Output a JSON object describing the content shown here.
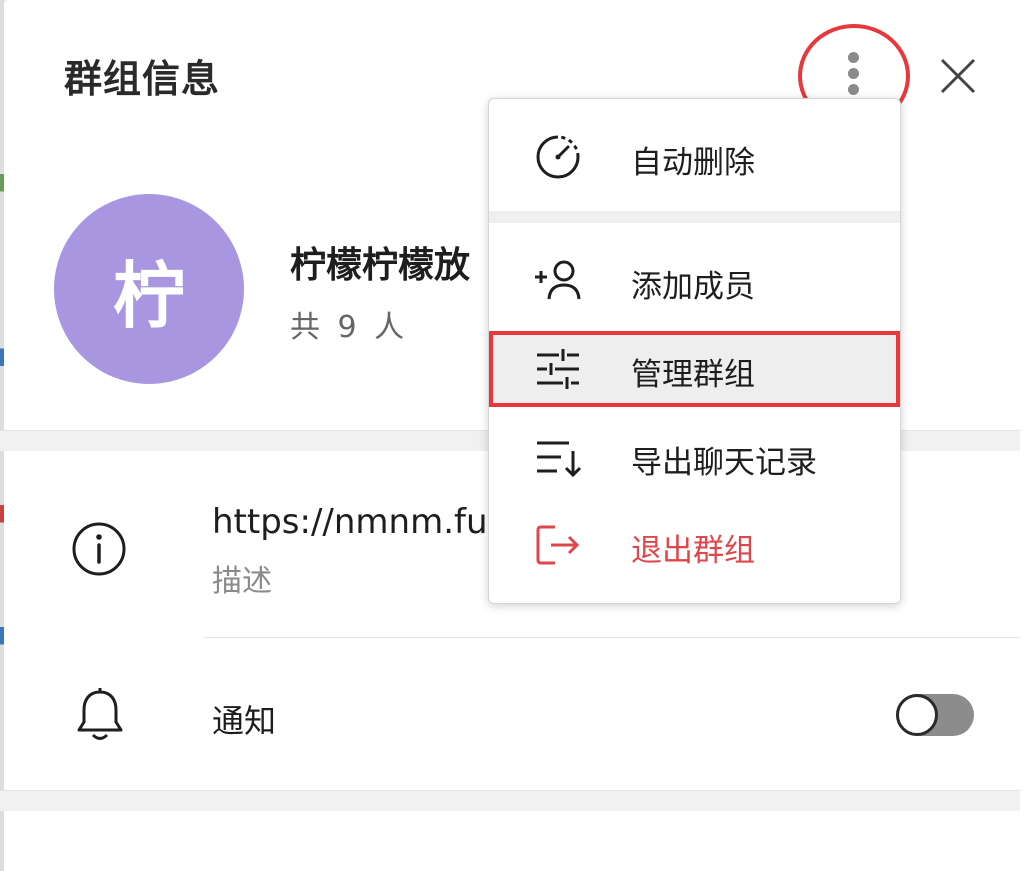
{
  "header": {
    "title": "群组信息"
  },
  "group": {
    "avatar_char": "柠",
    "avatar_color": "#a897e0",
    "name": "柠檬柠檬放",
    "member_count": "共 9 人"
  },
  "info": {
    "link": "https://nmnm.fun",
    "description_label": "描述"
  },
  "notifications": {
    "label": "通知",
    "enabled": false
  },
  "menu": {
    "items": [
      {
        "label": "自动删除",
        "icon": "timer-icon"
      },
      {
        "label": "添加成员",
        "icon": "add-user-icon"
      },
      {
        "label": "管理群组",
        "icon": "sliders-icon"
      },
      {
        "label": "导出聊天记录",
        "icon": "sort-down-icon"
      },
      {
        "label": "退出群组",
        "icon": "logout-icon"
      }
    ]
  },
  "colors": {
    "accent_red": "#e8383d",
    "danger_text": "#e0474c",
    "avatar": "#a897e0"
  }
}
